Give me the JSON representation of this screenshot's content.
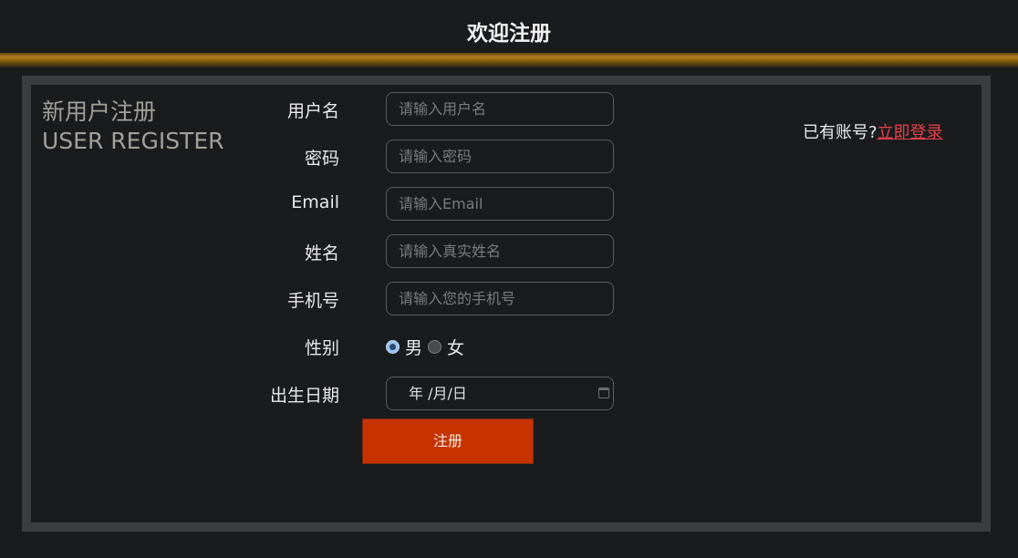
{
  "header": {
    "title": "欢迎注册"
  },
  "panel": {
    "title_cn": "新用户注册",
    "title_en": "USER REGISTER"
  },
  "form": {
    "username": {
      "label": "用户名",
      "placeholder": "请输入用户名",
      "value": ""
    },
    "password": {
      "label": "密码",
      "placeholder": "请输入密码",
      "value": ""
    },
    "email": {
      "label": "Email",
      "placeholder": "请输入Email",
      "value": ""
    },
    "realname": {
      "label": "姓名",
      "placeholder": "请输入真实姓名",
      "value": ""
    },
    "phone": {
      "label": "手机号",
      "placeholder": "请输入您的手机号",
      "value": ""
    },
    "gender": {
      "label": "性别",
      "options": [
        "男",
        "女"
      ],
      "selected": "男"
    },
    "birthday": {
      "label": "出生日期",
      "display": "年 /月/日"
    },
    "submit_label": "注册"
  },
  "login": {
    "prompt": "已有账号?",
    "link": "立即登录"
  },
  "colors": {
    "background": "#1a1b1d",
    "accent_button": "#c63300",
    "link": "#e5414b",
    "gold_bar": "#b17e1c"
  }
}
